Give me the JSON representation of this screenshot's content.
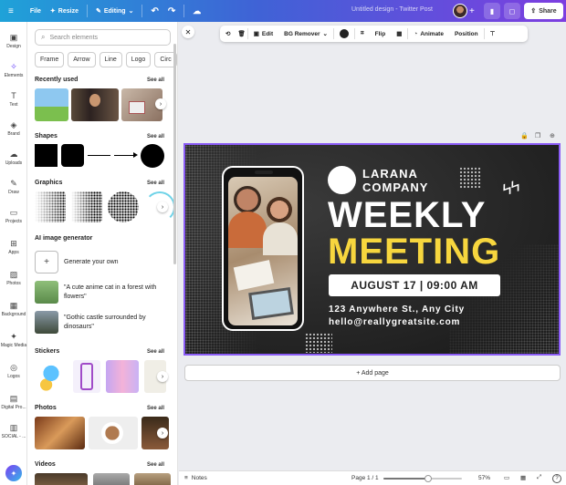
{
  "topbar": {
    "file": "File",
    "resize": "Resize",
    "editing": "Editing",
    "title": "Untitled design - Twitter Post",
    "share": "Share"
  },
  "rail": [
    {
      "label": "Design",
      "icon": "design-icon"
    },
    {
      "label": "Elements",
      "icon": "elements-icon"
    },
    {
      "label": "Text",
      "icon": "text-icon"
    },
    {
      "label": "Brand",
      "icon": "brand-icon"
    },
    {
      "label": "Uploads",
      "icon": "uploads-icon"
    },
    {
      "label": "Draw",
      "icon": "draw-icon"
    },
    {
      "label": "Projects",
      "icon": "projects-icon"
    },
    {
      "label": "Apps",
      "icon": "apps-icon"
    },
    {
      "label": "Photos",
      "icon": "photos-icon"
    },
    {
      "label": "Background",
      "icon": "background-icon"
    },
    {
      "label": "Magic Media",
      "icon": "magic-media-icon"
    },
    {
      "label": "Logos",
      "icon": "logos-icon"
    },
    {
      "label": "Digital Pro...",
      "icon": "digital-products-icon"
    },
    {
      "label": "SOCIAL - ...",
      "icon": "social-icon"
    }
  ],
  "panel": {
    "search_placeholder": "Search elements",
    "chips": [
      "Frame",
      "Arrow",
      "Line",
      "Logo",
      "Circ"
    ],
    "recently_used": "Recently used",
    "shapes": "Shapes",
    "graphics": "Graphics",
    "ai_generator": "AI image generator",
    "generate_own": "Generate your own",
    "prompt1": "\"A cute anime cat in a forest with flowers\"",
    "prompt2": "\"Gothic castle surrounded by dinosaurs\"",
    "stickers": "Stickers",
    "photos": "Photos",
    "videos": "Videos",
    "see_all": "See all"
  },
  "context_bar": {
    "edit": "Edit",
    "bg_remover": "BG Remover",
    "flip": "Flip",
    "animate": "Animate",
    "position": "Position"
  },
  "design": {
    "company_line1": "LARANA",
    "company_line2": "COMPANY",
    "headline1": "WEEKLY",
    "headline2": "MEETING",
    "datetime": "AUGUST 17 | 09:00 AM",
    "address": "123 Anywhere St., Any City",
    "email": "hello@reallygreatsite.com",
    "yellow": "#f7d63e"
  },
  "add_page": "+ Add page",
  "bottom": {
    "notes": "Notes",
    "page": "Page 1 / 1",
    "zoom": "57%",
    "zoom_level": 0.57
  }
}
